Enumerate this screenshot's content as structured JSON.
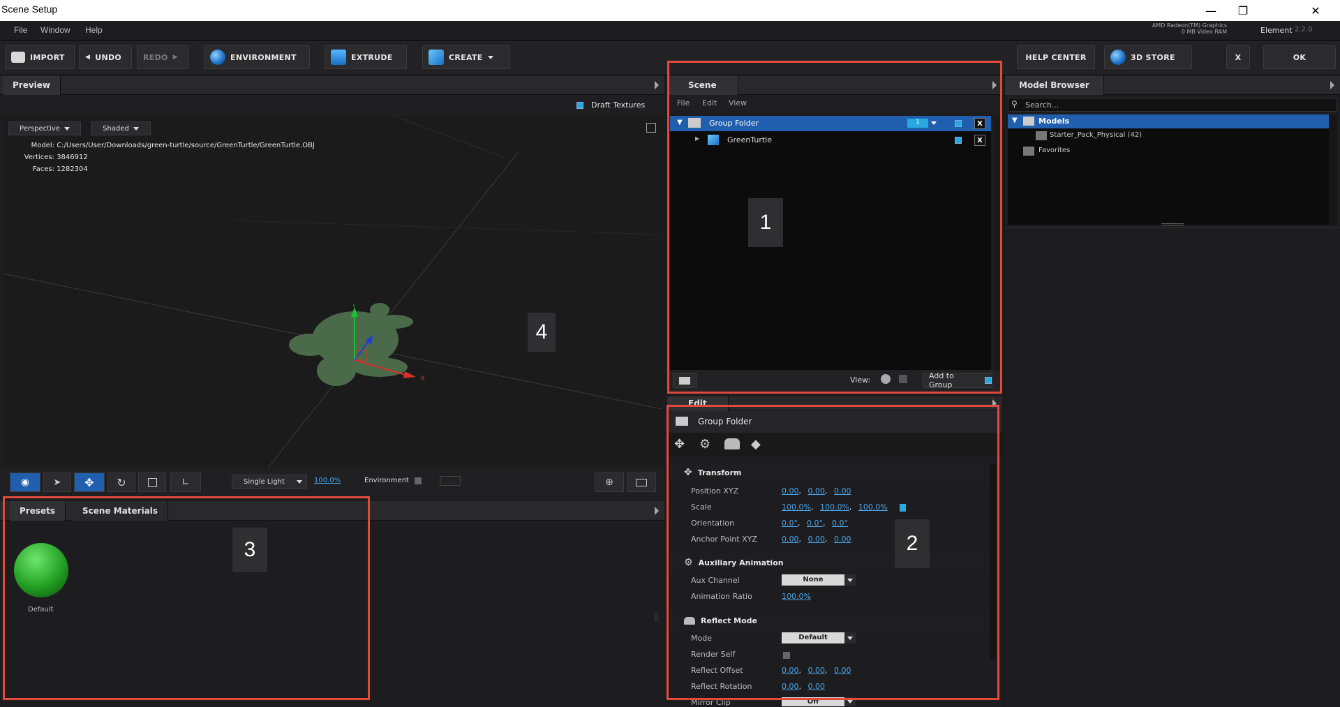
{
  "window": {
    "title": "Scene Setup"
  },
  "menu": [
    "File",
    "Window",
    "Help"
  ],
  "gpu": {
    "name": "AMD Radeon(TM) Graphics",
    "vram": "0 MB Video RAM"
  },
  "product": {
    "name": "Element",
    "version": "2.2.0"
  },
  "toolbar": {
    "import": "IMPORT",
    "undo": "UNDO",
    "redo": "REDO",
    "environment": "ENVIRONMENT",
    "extrude": "EXTRUDE",
    "create": "CREATE",
    "help_center": "HELP CENTER",
    "store": "3D STORE",
    "cancel": "X",
    "ok": "OK"
  },
  "preview": {
    "tab": "Preview",
    "draft_textures": "Draft Textures",
    "camera": "Perspective",
    "shading": "Shaded",
    "model_label": "Model:",
    "model_path": "C:/Users/User/Downloads/green-turtle/source/GreenTurtle/GreenTurtle.OBJ",
    "vertices_label": "Vertices:",
    "vertices": "3846912",
    "faces_label": "Faces:",
    "faces": "1282304",
    "annotation": "4",
    "lighting": "Single Light",
    "light_pct": "100.0%",
    "environment_label": "Environment",
    "axis_y": "Y",
    "axis_x": "X"
  },
  "materials": {
    "tabs": [
      "Presets",
      "Scene Materials"
    ],
    "items": [
      {
        "label": "Default",
        "color": "#22a022"
      }
    ],
    "annotation": "3"
  },
  "scene": {
    "tab": "Scene",
    "menu": [
      "File",
      "Edit",
      "View"
    ],
    "rows": [
      {
        "label": "Group Folder",
        "badge": "1"
      },
      {
        "label": "GreenTurtle"
      }
    ],
    "annotation": "1",
    "view_label": "View:",
    "add_to_group": "Add to Group"
  },
  "edit": {
    "tab": "Edit",
    "title": "Group Folder",
    "annotation": "2",
    "transform": {
      "title": "Transform",
      "position_label": "Position XYZ",
      "position": [
        "0.00",
        "0.00",
        "0.00"
      ],
      "scale_label": "Scale",
      "scale": [
        "100.0%",
        "100.0%",
        "100.0%"
      ],
      "orientation_label": "Orientation",
      "orientation": [
        "0.0°",
        "0.0°",
        "0.0°"
      ],
      "anchor_label": "Anchor Point XYZ",
      "anchor": [
        "0.00",
        "0.00",
        "0.00"
      ]
    },
    "aux": {
      "title": "Auxiliary Animation",
      "channel_label": "Aux Channel",
      "channel": "None",
      "ratio_label": "Animation Ratio",
      "ratio": "100.0%"
    },
    "reflect": {
      "title": "Reflect Mode",
      "mode_label": "Mode",
      "mode": "Default",
      "render_self_label": "Render Self",
      "offset_label": "Reflect Offset",
      "offset": [
        "0.00",
        "0.00",
        "0.00"
      ],
      "rotation_label": "Reflect Rotation",
      "rotation": [
        "0.00",
        "0.00"
      ],
      "mirror_label": "Mirror Clip",
      "mirror": "Off"
    }
  },
  "model_browser": {
    "tab": "Model Browser",
    "search_placeholder": "Search...",
    "tree": [
      {
        "label": "Models"
      },
      {
        "label": "Starter_Pack_Physical (42)"
      },
      {
        "label": "Favorites"
      }
    ]
  },
  "colors": {
    "highlight": "#e24a3b",
    "selection": "#1f5fae",
    "accent": "#29a8e0"
  }
}
